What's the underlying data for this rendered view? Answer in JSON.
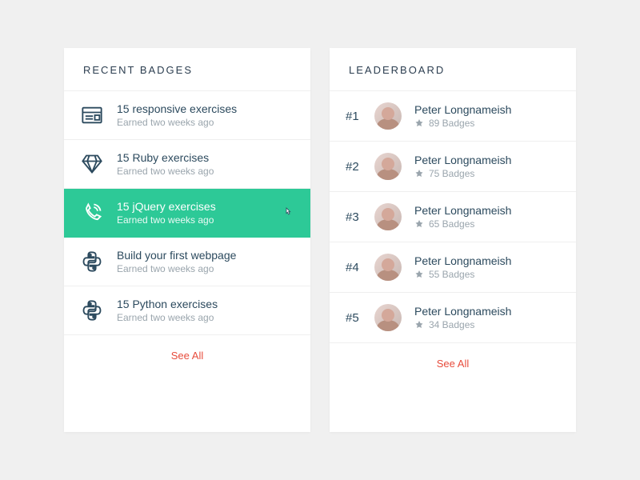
{
  "colors": {
    "accent": "#2dc997",
    "danger": "#e74c3c",
    "text": "#2c4a5e",
    "muted": "#9aa5ad"
  },
  "badges_card": {
    "header": "RECENT BADGES",
    "see_all": "See All",
    "items": [
      {
        "icon": "browser-icon",
        "title": "15 responsive exercises",
        "sub": "Earned two weeks ago",
        "selected": false
      },
      {
        "icon": "diamond-icon",
        "title": "15 Ruby exercises",
        "sub": "Earned two weeks ago",
        "selected": false
      },
      {
        "icon": "phone-icon",
        "title": "15 jQuery exercises",
        "sub": "Earned two weeks ago",
        "selected": true
      },
      {
        "icon": "python-icon",
        "title": "Build your first webpage",
        "sub": "Earned two weeks ago",
        "selected": false
      },
      {
        "icon": "python-icon",
        "title": "15 Python exercises",
        "sub": "Earned two weeks ago",
        "selected": false
      }
    ]
  },
  "leaderboard_card": {
    "header": "LEADERBOARD",
    "see_all": "See All",
    "items": [
      {
        "rank": "#1",
        "name": "Peter Longnameish",
        "badges": "89 Badges"
      },
      {
        "rank": "#2",
        "name": "Peter Longnameish",
        "badges": "75 Badges"
      },
      {
        "rank": "#3",
        "name": "Peter Longnameish",
        "badges": "65 Badges"
      },
      {
        "rank": "#4",
        "name": "Peter Longnameish",
        "badges": "55 Badges"
      },
      {
        "rank": "#5",
        "name": "Peter Longnameish",
        "badges": "34 Badges"
      }
    ]
  }
}
